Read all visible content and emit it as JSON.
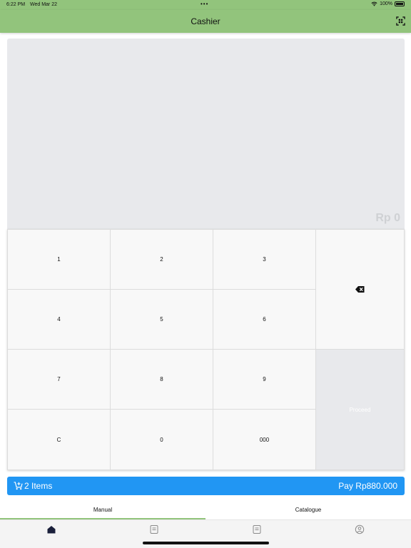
{
  "status_bar": {
    "time": "6:22 PM",
    "date": "Wed Mar 22",
    "dots": "•••",
    "battery": "100%"
  },
  "app_bar": {
    "title": "Cashier",
    "scan_icon": "qr-scan-icon"
  },
  "display": {
    "amount": "Rp 0"
  },
  "keypad": {
    "keys": [
      "1",
      "2",
      "3",
      "4",
      "5",
      "6",
      "7",
      "8",
      "9",
      "C",
      "0",
      "000"
    ],
    "backspace_icon": "backspace-icon",
    "proceed_label": "Proceed"
  },
  "cart": {
    "items_label": "2 Items",
    "pay_label": "Pay Rp880.000",
    "cart_icon": "cart-add-icon"
  },
  "tabs": [
    {
      "label": "Manual"
    },
    {
      "label": "Catalogue"
    }
  ],
  "nav": [
    {
      "icon": "home-icon"
    },
    {
      "icon": "note-icon"
    },
    {
      "icon": "receipt-icon"
    },
    {
      "icon": "account-icon"
    }
  ],
  "colors": {
    "accent_green": "#92c47c",
    "primary_blue": "#2196f3",
    "display_bg": "#e8e9ec"
  }
}
